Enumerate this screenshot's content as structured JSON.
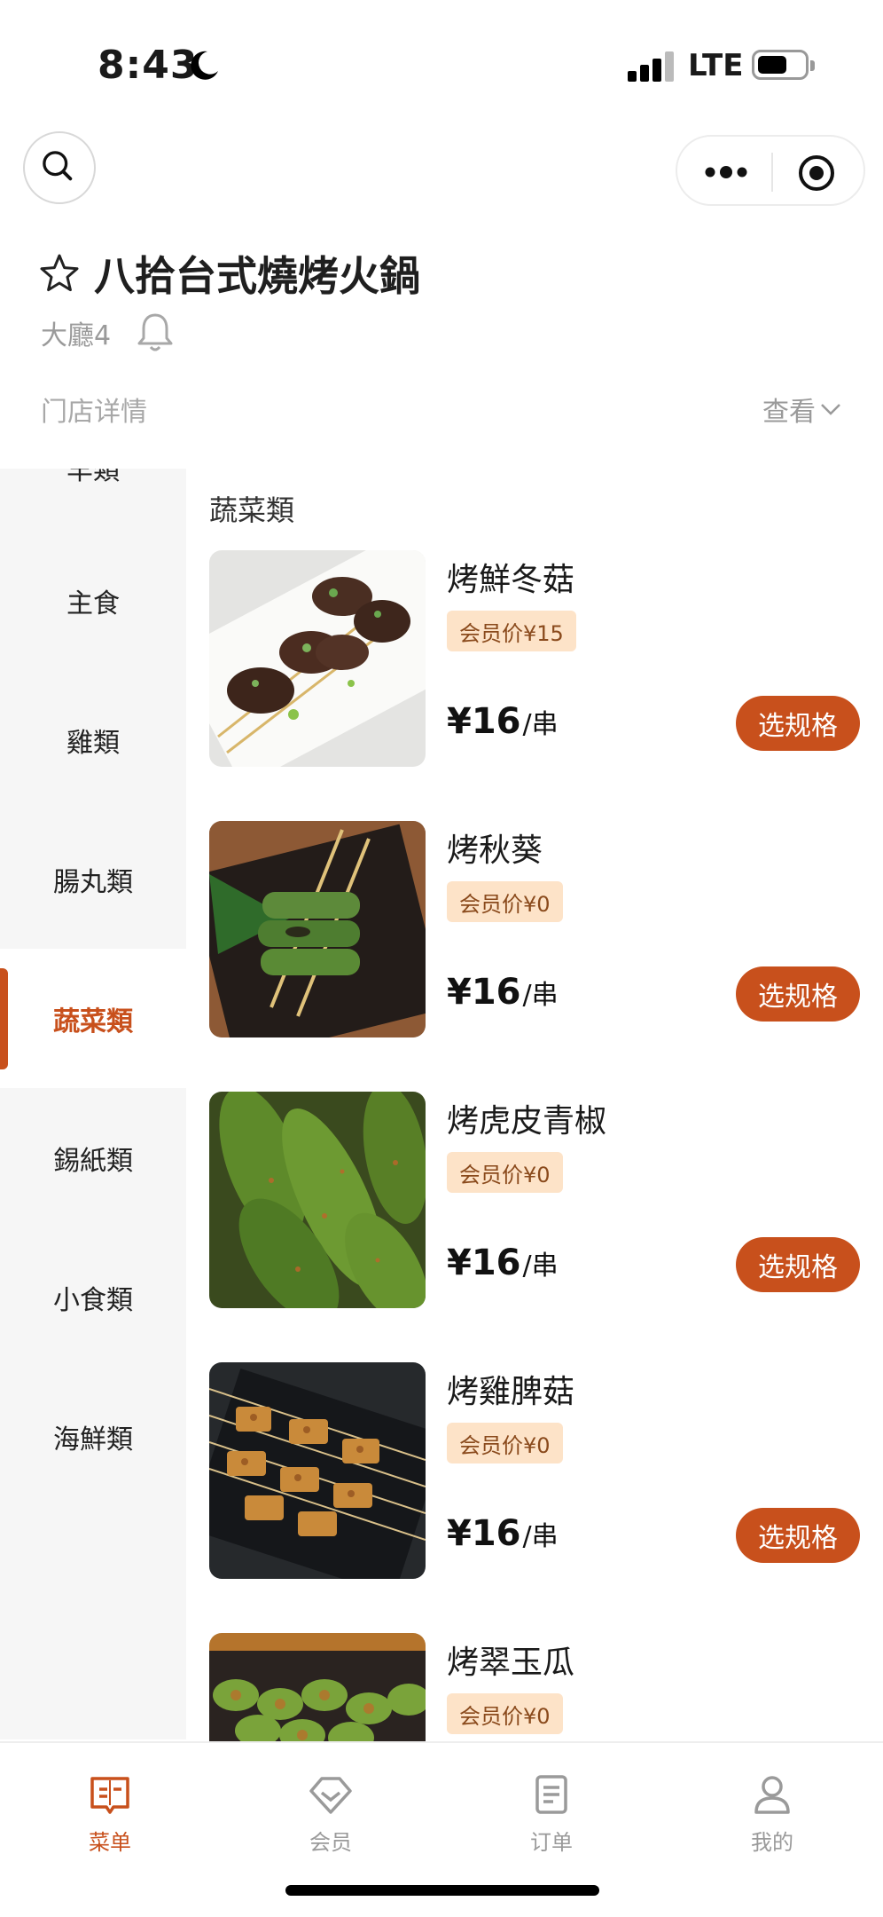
{
  "status_bar": {
    "time": "8:43",
    "network": "LTE"
  },
  "store": {
    "name": "八拾台式燒烤火鍋",
    "table": "大廳4",
    "detail_label": "门店详情",
    "view_label": "查看"
  },
  "sidebar": {
    "items": [
      {
        "label": "羊類",
        "active": false
      },
      {
        "label": "主食",
        "active": false
      },
      {
        "label": "雞類",
        "active": false
      },
      {
        "label": "腸丸類",
        "active": false
      },
      {
        "label": "蔬菜類",
        "active": true
      },
      {
        "label": "錫紙類",
        "active": false
      },
      {
        "label": "小食類",
        "active": false
      },
      {
        "label": "海鮮類",
        "active": false
      }
    ]
  },
  "section": {
    "title": "蔬菜類"
  },
  "products": [
    {
      "name": "烤鮮冬菇",
      "member_price": "会员价¥15",
      "price": "¥16",
      "unit": "/串",
      "button": "选规格"
    },
    {
      "name": "烤秋葵",
      "member_price": "会员价¥0",
      "price": "¥16",
      "unit": "/串",
      "button": "选规格"
    },
    {
      "name": "烤虎皮青椒",
      "member_price": "会员价¥0",
      "price": "¥16",
      "unit": "/串",
      "button": "选规格"
    },
    {
      "name": "烤雞脾菇",
      "member_price": "会员价¥0",
      "price": "¥16",
      "unit": "/串",
      "button": "选规格"
    },
    {
      "name": "烤翠玉瓜",
      "member_price": "会员价¥0"
    }
  ],
  "tabbar": {
    "items": [
      {
        "label": "菜单",
        "icon": "menu-book-icon",
        "active": true
      },
      {
        "label": "会员",
        "icon": "member-diamond-icon",
        "active": false
      },
      {
        "label": "订单",
        "icon": "order-list-icon",
        "active": false
      },
      {
        "label": "我的",
        "icon": "profile-icon",
        "active": false
      }
    ]
  },
  "colors": {
    "accent": "#c8501c",
    "member_tag_bg": "#fde3c8",
    "sidebar_bg": "#f6f6f6"
  }
}
